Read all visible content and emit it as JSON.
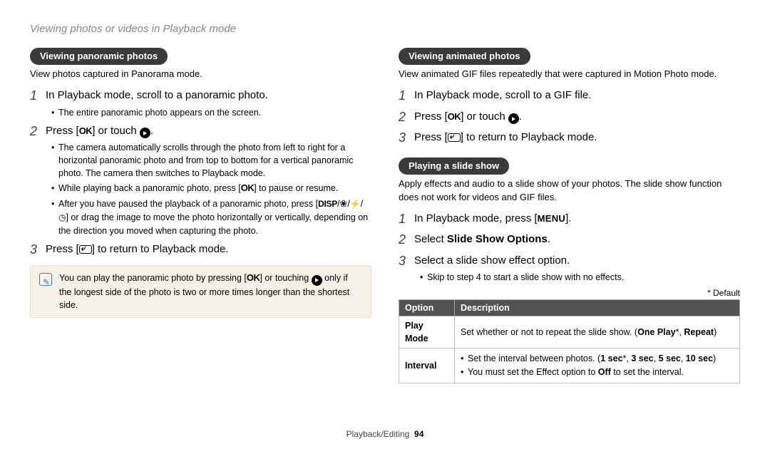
{
  "header": "Viewing photos or videos in Playback mode",
  "left": {
    "heading": "Viewing panoramic photos",
    "lead": "View photos captured in Panorama mode.",
    "step1": "In Playback mode, scroll to a panoramic photo.",
    "step1_b1": "The entire panoramic photo appears on the screen.",
    "step2_a": "Press [",
    "step2_b": "] or touch ",
    "step2_c": ".",
    "step2_b1": "The camera automatically scrolls through the photo from left to right for a horizontal panoramic photo and from top to bottom for a vertical panoramic photo. The camera then switches to Playback mode.",
    "step2_b2_a": "While playing back a panoramic photo, press [",
    "step2_b2_b": "] to pause or resume.",
    "step2_b3_a": "After you have paused the playback of a panoramic photo, press [",
    "step2_b3_b": "] or drag the image to move the photo horizontally or vertically, depending on the direction you moved when capturing the photo.",
    "step3_a": "Press [",
    "step3_b": "] to return to Playback mode.",
    "note_a": "You can play the panoramic photo by pressing [",
    "note_b": "] or touching ",
    "note_c": " only if the longest side of the photo is two or more times longer than the shortest side."
  },
  "right": {
    "heading1": "Viewing animated photos",
    "lead1": "View animated GIF files repeatedly that were captured in Motion Photo mode.",
    "r1_step1": "In Playback mode, scroll to a GIF file.",
    "r1_step2_a": "Press [",
    "r1_step2_b": "] or touch ",
    "r1_step2_c": ".",
    "r1_step3_a": "Press [",
    "r1_step3_b": "] to return to Playback mode.",
    "heading2": "Playing a slide show",
    "lead2": "Apply effects and audio to a slide show of your photos. The slide show function does not work for videos and GIF files.",
    "r2_step1_a": "In Playback mode, press [",
    "r2_step1_b": "].",
    "r2_step2_a": "Select ",
    "r2_step2_bold": "Slide Show Options",
    "r2_step2_b": ".",
    "r2_step3": "Select a slide show effect option.",
    "r2_step3_b1": "Skip to step 4 to start a slide show with no effects.",
    "default_note": "* Default",
    "table": {
      "h1": "Option",
      "h2": "Description",
      "row1_label": "Play Mode",
      "row1_desc_a": "Set whether or not to repeat the slide show. (",
      "row1_desc_b1": "One Play",
      "row1_desc_mid": "*, ",
      "row1_desc_b2": "Repeat",
      "row1_desc_c": ")",
      "row2_label": "Interval",
      "row2_li1_a": "Set the interval between photos. (",
      "row2_li1_b": "1 sec",
      "row2_li1_mid1": "*, ",
      "row2_li1_c": "3 sec",
      "row2_li1_mid2": ", ",
      "row2_li1_d": "5 sec",
      "row2_li1_mid3": ", ",
      "row2_li1_e": "10 sec",
      "row2_li1_f": ")",
      "row2_li2_a": "You must set the Effect option to ",
      "row2_li2_b": "Off",
      "row2_li2_c": " to set the interval."
    }
  },
  "footer": {
    "section": "Playback/Editing",
    "page": "94"
  }
}
